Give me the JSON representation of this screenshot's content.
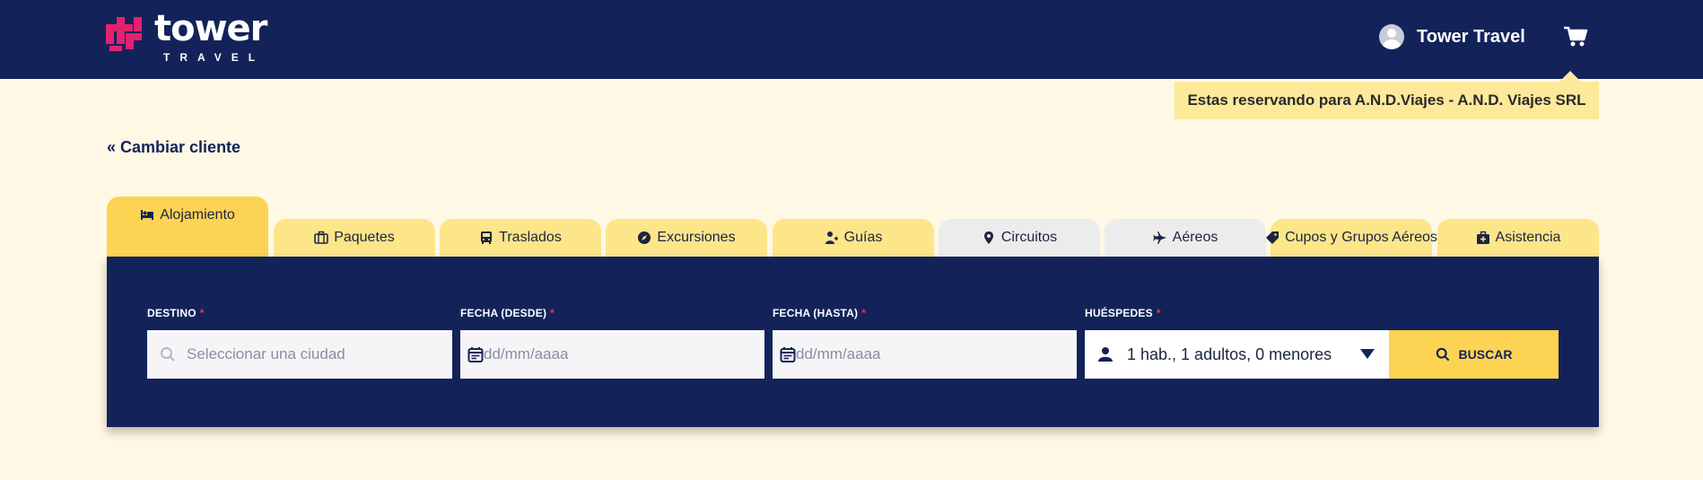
{
  "brand": {
    "name": "tower",
    "sub": "TRAVEL",
    "accent": "#e4216f",
    "navy": "#13235a",
    "yellow": "#fdd354"
  },
  "header": {
    "user_name": "Tower Travel",
    "cart_icon": "cart-icon",
    "avatar_icon": "user-avatar-icon"
  },
  "notice": {
    "text": "Estas reservando para A.N.D.Viajes - A.N.D. Viajes SRL"
  },
  "change_client": {
    "label": "« Cambiar cliente"
  },
  "tabs": [
    {
      "label": "Alojamiento",
      "icon": "bed-icon"
    },
    {
      "label": "Paquetes",
      "icon": "suitcase-icon"
    },
    {
      "label": "Traslados",
      "icon": "bus-icon"
    },
    {
      "label": "Excursiones",
      "icon": "compass-icon"
    },
    {
      "label": "Guías",
      "icon": "guide-icon"
    },
    {
      "label": "Circuitos",
      "icon": "map-pin-icon"
    },
    {
      "label": "Aéreos",
      "icon": "plane-icon"
    },
    {
      "label": "Cupos y Grupos Aéreos",
      "icon": "tag-icon"
    },
    {
      "label": "Asistencia",
      "icon": "medkit-icon"
    }
  ],
  "form": {
    "destino": {
      "label": "DESTINO",
      "required": "*",
      "placeholder": "Seleccionar una ciudad"
    },
    "fecha_desde": {
      "label": "FECHA (DESDE)",
      "required": "*",
      "placeholder": "dd/mm/aaaa"
    },
    "fecha_hasta": {
      "label": "FECHA (HASTA)",
      "required": "*",
      "placeholder": "dd/mm/aaaa"
    },
    "huespedes": {
      "label": "HUÉSPEDES",
      "required": "*",
      "value": "1 hab., 1 adultos, 0 menores"
    },
    "search": {
      "label": "BUSCAR"
    }
  }
}
